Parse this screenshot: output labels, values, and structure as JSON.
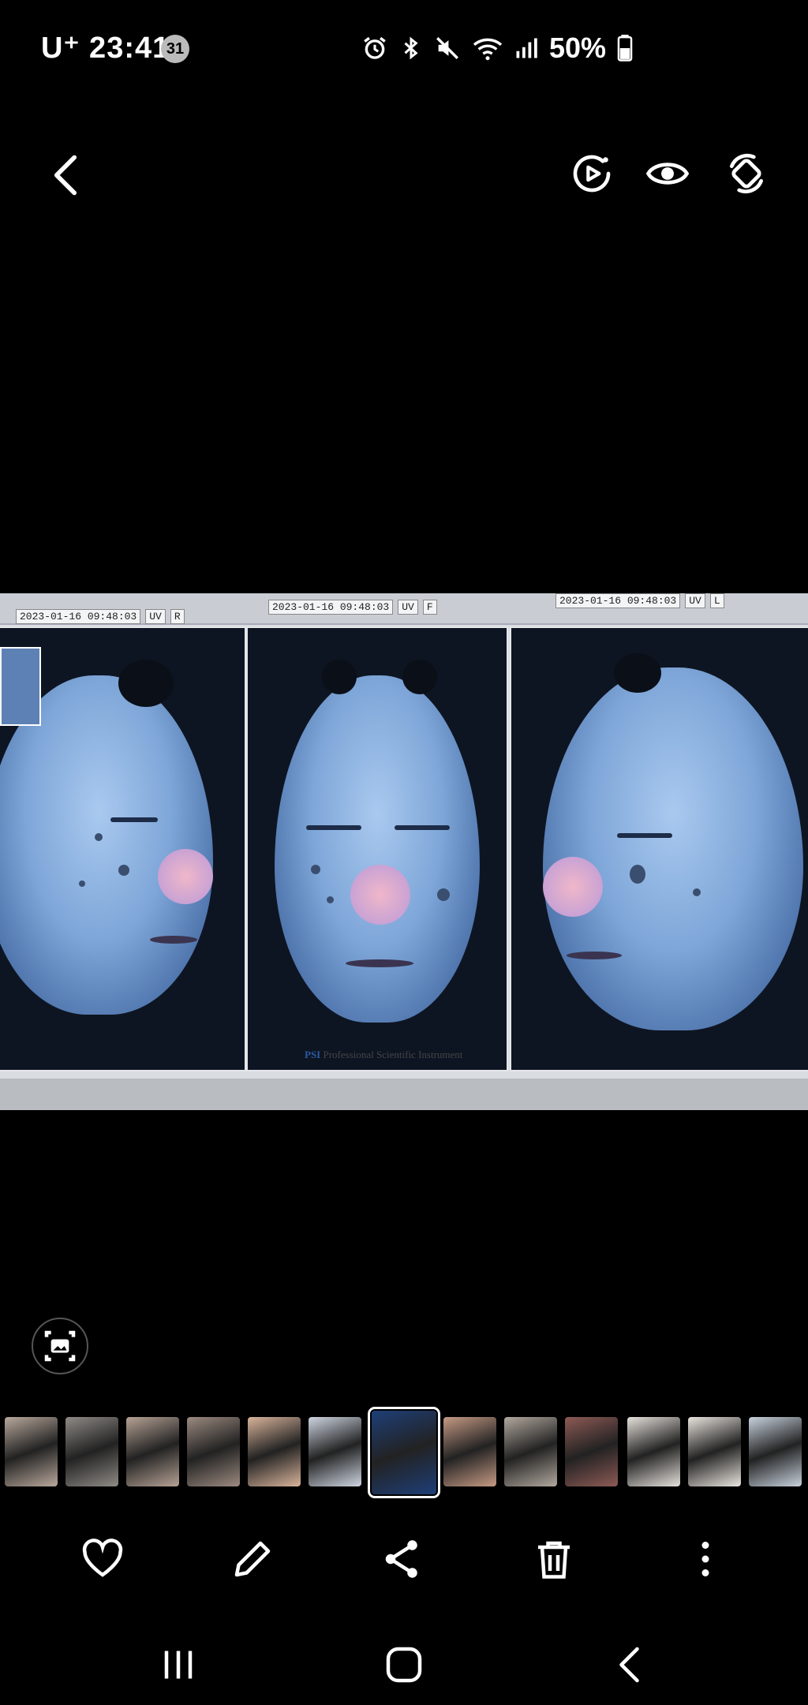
{
  "status_bar": {
    "carrier_time": "U⁺ 23:41",
    "notification_count": "31",
    "battery": "50%"
  },
  "viewer": {
    "top_actions": [
      "back-icon",
      "motion-photo-icon",
      "view-icon",
      "rotate-icon"
    ],
    "photo": {
      "panels": [
        {
          "date": "2023-01-16 09:48:03",
          "mode": "UV",
          "side": "R"
        },
        {
          "date": "2023-01-16 09:48:03",
          "mode": "UV",
          "side": "F"
        },
        {
          "date": "2023-01-16 09:48:03",
          "mode": "UV",
          "side": "L"
        }
      ],
      "brand_prefix": "PSI",
      "brand_text": "Professional Scientific Instrument"
    },
    "lens_icon": "image-lens-icon"
  },
  "filmstrip": {
    "selected_index": 6,
    "thumb_colors": [
      "#b9a89c",
      "#8f8b86",
      "#b6a295",
      "#9c8a80",
      "#d9b49b",
      "#cfd6e2",
      "#1e3f78",
      "#c69a84",
      "#b2a89e",
      "#8d5a55",
      "#e6e1dc",
      "#e9e4de",
      "#c8d2de"
    ]
  },
  "actions": {
    "favorite": "heart-icon",
    "edit": "pencil-icon",
    "share": "share-icon",
    "delete": "trash-icon",
    "more": "more-vertical-icon"
  },
  "navbar": {
    "recents": "recents-icon",
    "home": "home-icon",
    "back": "nav-back-icon"
  },
  "colors": {
    "background": "#000000",
    "icon": "#ffffff"
  }
}
